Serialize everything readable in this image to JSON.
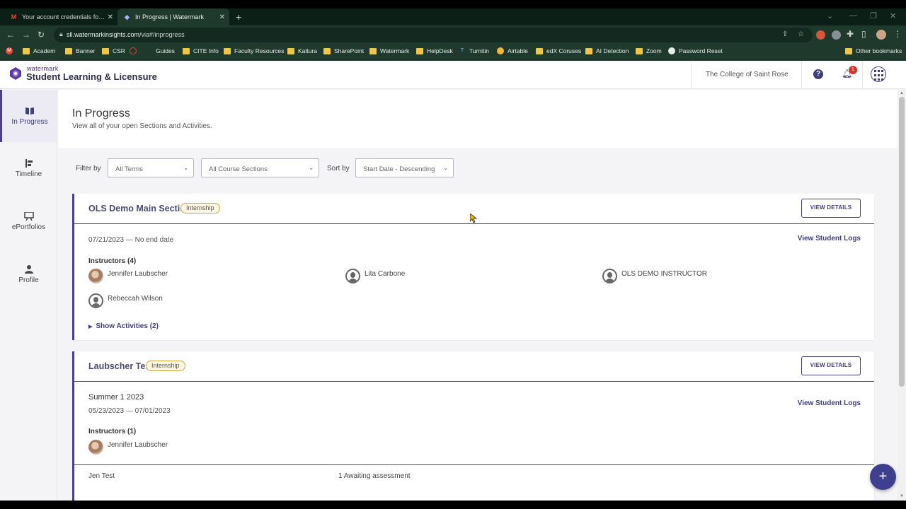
{
  "browser": {
    "tabs": [
      {
        "title": "Your account credentials for Wat",
        "icon": "gmail-icon"
      },
      {
        "title": "In Progress | Watermark",
        "icon": "watermark-icon"
      }
    ],
    "url_host": "sll.watermarkinsights.com",
    "url_path": "/via#/inprogress",
    "bookmarks": [
      "Academ",
      "Banner",
      "CSR",
      "Guides",
      "CITE Info",
      "Faculty Resources",
      "Kaltura",
      "SharePoint",
      "Watermark",
      "HelpDesk",
      "Turnitin",
      "Airtable",
      "edX Coruses",
      "AI Detection",
      "Zoom",
      "Password Reset"
    ],
    "other_bookmarks": "Other bookmarks",
    "ext_badge": "3"
  },
  "header": {
    "logo_top": "watermark",
    "logo_main": "Student Learning & Licensure",
    "college": "The College of Saint Rose",
    "help": "?",
    "notification_count": "1"
  },
  "sidebar": {
    "items": [
      {
        "label": "In Progress",
        "icon": "book-icon"
      },
      {
        "label": "Timeline",
        "icon": "timeline-icon"
      },
      {
        "label": "ePortfolios",
        "icon": "easel-icon"
      },
      {
        "label": "Profile",
        "icon": "person-icon"
      }
    ]
  },
  "page": {
    "title": "In Progress",
    "subtitle": "View all of your open Sections and Activities."
  },
  "filters": {
    "filter_by_label": "Filter by",
    "terms_value": "All Terms",
    "sections_value": "All Course Sections",
    "sort_by_label": "Sort by",
    "sort_value": "Start Date - Descending"
  },
  "cards": [
    {
      "title": "OLS Demo Main Section",
      "tag": "Internship",
      "view_details": "VIEW DETAILS",
      "view_logs": "View Student Logs",
      "dates": "07/21/2023 — No end date",
      "instructors_heading": "Instructors (4)",
      "instructors": [
        "Jennifer Laubscher",
        "Lita Carbone",
        "OLS DEMO INSTRUCTOR",
        "Rebeccah Wilson"
      ],
      "show_activities": "Show Activities (2)"
    },
    {
      "title": "Laubscher Test",
      "tag": "Internship",
      "view_details": "VIEW DETAILS",
      "view_logs": "View Student Logs",
      "term": "Summer 1 2023",
      "dates": "05/23/2023 — 07/01/2023",
      "instructors_heading": "Instructors (1)",
      "instructors": [
        "Jennifer Laubscher"
      ],
      "student_name": "Jen Test",
      "student_status": "1 Awaiting assessment"
    }
  ],
  "fab_label": "+"
}
